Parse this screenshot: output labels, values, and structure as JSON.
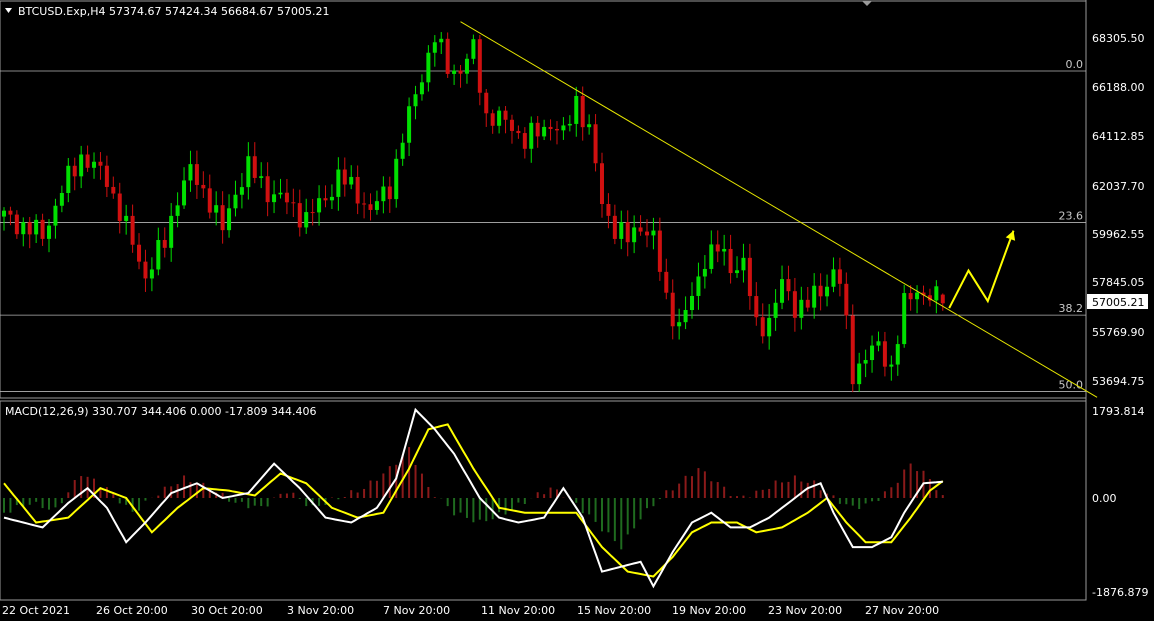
{
  "window": {
    "symbol_header": "BTCUSD.Exp,H4  57374.67 57424.34 56684.67 57005.21"
  },
  "price_axis": {
    "labels": [
      "68305.50",
      "66188.00",
      "64112.85",
      "62037.70",
      "59962.55",
      "57845.05",
      "55769.90",
      "53694.75"
    ],
    "current_price": "57005.21"
  },
  "fib_levels": [
    {
      "label": "0.0",
      "price": 66900
    },
    {
      "label": "23.6",
      "price": 60450
    },
    {
      "label": "38.2",
      "price": 56500
    },
    {
      "label": "50.0",
      "price": 53250
    }
  ],
  "macd": {
    "header": "MACD(12,26,9) 330.707 344.406 0.000 -17.809 344.406",
    "axis_labels": [
      "1793.814",
      "0.00",
      "-1876.879"
    ]
  },
  "time_axis": {
    "labels": [
      "22 Oct 2021",
      "26 Oct 20:00",
      "30 Oct 20:00",
      "3 Nov 20:00",
      "7 Nov 20:00",
      "11 Nov 20:00",
      "15 Nov 20:00",
      "19 Nov 20:00",
      "23 Nov 20:00",
      "27 Nov 20:00"
    ]
  },
  "colors": {
    "background": "#000000",
    "bull_candle": "#00e000",
    "bear_candle": "#d01010",
    "trendline": "#e6e600",
    "projection_arrow": "#ffff00",
    "macd_line": "#ffffff",
    "signal_line": "#ffff00",
    "hist_positive": "#8b1a1a",
    "hist_negative": "#1f6b1f",
    "grid_line": "#b4b4b4"
  },
  "chart_data": {
    "type": "candlestick",
    "symbol": "BTCUSD.Exp",
    "timeframe": "H4",
    "last_bar": {
      "open": 57374.67,
      "high": 57424.34,
      "low": 56684.67,
      "close": 57005.21
    },
    "ylim": [
      53000,
      69500
    ],
    "close_path": [
      [
        0,
        60700
      ],
      [
        6,
        59900
      ],
      [
        9,
        61800
      ],
      [
        12,
        63300
      ],
      [
        16,
        62300
      ],
      [
        19,
        60200
      ],
      [
        22,
        58200
      ],
      [
        25,
        59600
      ],
      [
        27,
        61600
      ],
      [
        29,
        62600
      ],
      [
        32,
        61400
      ],
      [
        34,
        60100
      ],
      [
        36,
        61800
      ],
      [
        38,
        62800
      ],
      [
        41,
        61800
      ],
      [
        44,
        61300
      ],
      [
        47,
        60600
      ],
      [
        50,
        61500
      ],
      [
        52,
        62400
      ],
      [
        55,
        61700
      ],
      [
        57,
        60900
      ],
      [
        60,
        62000
      ],
      [
        63,
        65000
      ],
      [
        65,
        66800
      ],
      [
        67,
        68300
      ],
      [
        69,
        67100
      ],
      [
        71,
        66900
      ],
      [
        73,
        67800
      ],
      [
        75,
        65000
      ],
      [
        77,
        64800
      ],
      [
        79,
        64600
      ],
      [
        81,
        63900
      ],
      [
        83,
        64300
      ],
      [
        85,
        64700
      ],
      [
        87,
        64100
      ],
      [
        89,
        65700
      ],
      [
        91,
        64300
      ],
      [
        93,
        61300
      ],
      [
        95,
        60200
      ],
      [
        97,
        59700
      ],
      [
        99,
        60400
      ],
      [
        101,
        59700
      ],
      [
        103,
        57200
      ],
      [
        105,
        56000
      ],
      [
        107,
        57200
      ],
      [
        109,
        59000
      ],
      [
        111,
        59300
      ],
      [
        113,
        58600
      ],
      [
        115,
        58700
      ],
      [
        117,
        56000
      ],
      [
        119,
        56300
      ],
      [
        121,
        57800
      ],
      [
        123,
        56900
      ],
      [
        125,
        57000
      ],
      [
        127,
        57500
      ],
      [
        129,
        58400
      ],
      [
        130,
        57900
      ],
      [
        132,
        54000
      ],
      [
        134,
        54800
      ],
      [
        136,
        55100
      ],
      [
        138,
        54300
      ],
      [
        140,
        56900
      ],
      [
        142,
        57600
      ],
      [
        144,
        57300
      ],
      [
        146,
        57005.21
      ]
    ],
    "trendline": [
      [
        71,
        69000
      ],
      [
        170,
        53000
      ]
    ],
    "projection": [
      [
        147,
        56800
      ],
      [
        150,
        58400
      ],
      [
        153,
        57100
      ],
      [
        157,
        60100
      ]
    ],
    "macd": {
      "ylim": [
        -1876.879,
        1793.814
      ],
      "macd_path": [
        [
          0,
          -400
        ],
        [
          6,
          -600
        ],
        [
          10,
          -100
        ],
        [
          13,
          200
        ],
        [
          16,
          -200
        ],
        [
          19,
          -900
        ],
        [
          22,
          -500
        ],
        [
          26,
          100
        ],
        [
          30,
          300
        ],
        [
          34,
          0
        ],
        [
          38,
          100
        ],
        [
          42,
          700
        ],
        [
          46,
          200
        ],
        [
          50,
          -400
        ],
        [
          54,
          -500
        ],
        [
          58,
          -200
        ],
        [
          61,
          400
        ],
        [
          64,
          1800
        ],
        [
          67,
          1400
        ],
        [
          70,
          900
        ],
        [
          74,
          0
        ],
        [
          77,
          -400
        ],
        [
          80,
          -500
        ],
        [
          84,
          -400
        ],
        [
          87,
          200
        ],
        [
          90,
          -400
        ],
        [
          93,
          -1500
        ],
        [
          96,
          -1400
        ],
        [
          99,
          -1300
        ],
        [
          101,
          -1800
        ],
        [
          104,
          -1100
        ],
        [
          107,
          -500
        ],
        [
          110,
          -300
        ],
        [
          113,
          -600
        ],
        [
          116,
          -600
        ],
        [
          119,
          -400
        ],
        [
          122,
          -100
        ],
        [
          125,
          200
        ],
        [
          127,
          300
        ],
        [
          129,
          -300
        ],
        [
          132,
          -1000
        ],
        [
          135,
          -1000
        ],
        [
          138,
          -800
        ],
        [
          140,
          -300
        ],
        [
          143,
          300
        ],
        [
          146,
          330.707
        ]
      ],
      "signal_path": [
        [
          0,
          300
        ],
        [
          5,
          -500
        ],
        [
          10,
          -400
        ],
        [
          15,
          200
        ],
        [
          19,
          0
        ],
        [
          23,
          -700
        ],
        [
          27,
          -200
        ],
        [
          31,
          200
        ],
        [
          35,
          150
        ],
        [
          39,
          50
        ],
        [
          43,
          500
        ],
        [
          47,
          300
        ],
        [
          51,
          -200
        ],
        [
          55,
          -400
        ],
        [
          59,
          -300
        ],
        [
          63,
          600
        ],
        [
          66,
          1400
        ],
        [
          69,
          1500
        ],
        [
          73,
          600
        ],
        [
          77,
          -200
        ],
        [
          81,
          -300
        ],
        [
          85,
          -300
        ],
        [
          89,
          -300
        ],
        [
          93,
          -1000
        ],
        [
          97,
          -1500
        ],
        [
          101,
          -1600
        ],
        [
          104,
          -1200
        ],
        [
          107,
          -700
        ],
        [
          110,
          -500
        ],
        [
          114,
          -500
        ],
        [
          117,
          -700
        ],
        [
          121,
          -600
        ],
        [
          125,
          -300
        ],
        [
          128,
          0
        ],
        [
          131,
          -500
        ],
        [
          134,
          -900
        ],
        [
          138,
          -900
        ],
        [
          141,
          -400
        ],
        [
          144,
          150
        ],
        [
          146,
          344.406
        ]
      ],
      "histogram_peaks": [
        [
          0,
          -300
        ],
        [
          4,
          -100
        ],
        [
          8,
          -250
        ],
        [
          12,
          500
        ],
        [
          16,
          200
        ],
        [
          20,
          -300
        ],
        [
          24,
          100
        ],
        [
          28,
          400
        ],
        [
          32,
          200
        ],
        [
          36,
          -100
        ],
        [
          40,
          -200
        ],
        [
          44,
          150
        ],
        [
          48,
          -200
        ],
        [
          52,
          0
        ],
        [
          56,
          200
        ],
        [
          60,
          600
        ],
        [
          63,
          1000
        ],
        [
          66,
          200
        ],
        [
          70,
          -300
        ],
        [
          74,
          -500
        ],
        [
          78,
          -300
        ],
        [
          82,
          0
        ],
        [
          85,
          200
        ],
        [
          88,
          0
        ],
        [
          92,
          -500
        ],
        [
          96,
          -1000
        ],
        [
          99,
          -400
        ],
        [
          102,
          0
        ],
        [
          105,
          300
        ],
        [
          108,
          600
        ],
        [
          111,
          300
        ],
        [
          114,
          0
        ],
        [
          117,
          100
        ],
        [
          120,
          300
        ],
        [
          123,
          400
        ],
        [
          126,
          300
        ],
        [
          129,
          0
        ],
        [
          132,
          -200
        ],
        [
          135,
          -100
        ],
        [
          138,
          200
        ],
        [
          141,
          700
        ],
        [
          144,
          400
        ],
        [
          146,
          0
        ]
      ]
    }
  }
}
